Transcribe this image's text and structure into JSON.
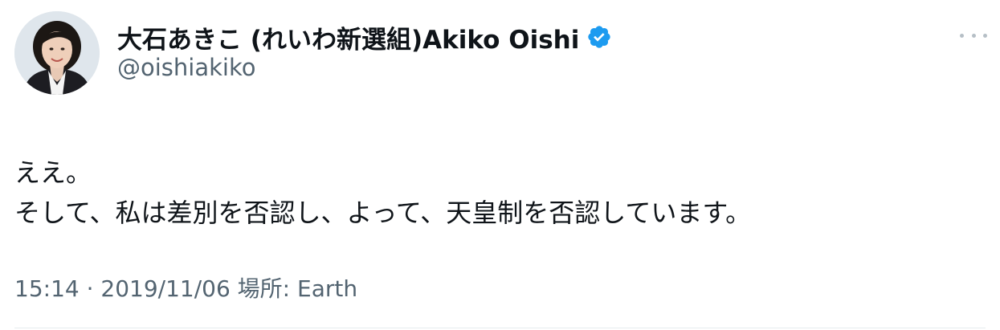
{
  "author": {
    "display_name": "大石あきこ (れいわ新選組)Akiko Oishi",
    "handle": "@oishiakiko",
    "verified": true,
    "avatar": "profile-photo"
  },
  "tweet": {
    "lines": [
      "ええ。",
      "そして、私は差別を否認し、よって、天皇制を否認しています。"
    ],
    "timestamp": "15:14 · 2019/11/06 場所: Earth"
  },
  "icons": {
    "more": "more-options-icon",
    "verified": "verified-badge-icon"
  },
  "colors": {
    "text": "#0f1419",
    "secondary": "#536471",
    "verified": "#1d9bf0"
  }
}
